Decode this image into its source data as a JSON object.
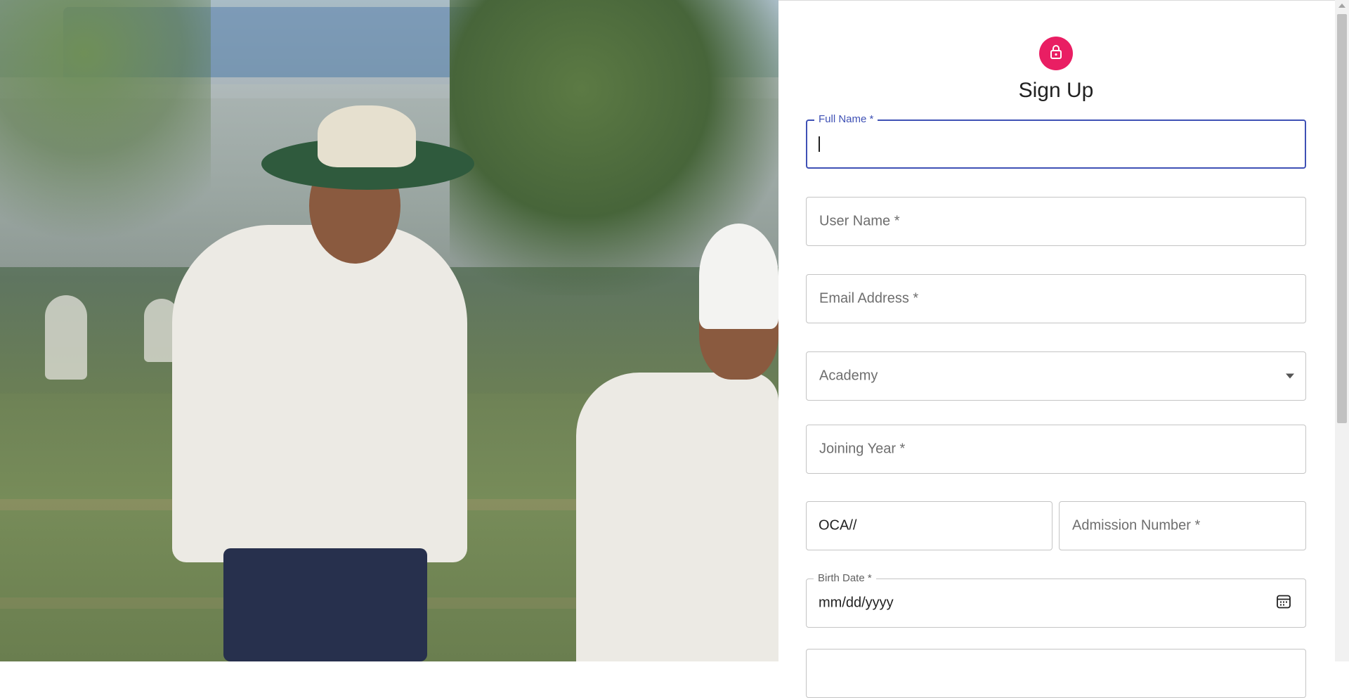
{
  "page": {
    "title": "Sign Up"
  },
  "theme": {
    "accent": "#e91e63",
    "focus": "#3f51b5",
    "border": "#c4c4c4"
  },
  "icons": {
    "lock": "lock-icon",
    "calendar": "calendar-icon",
    "dropdown": "chevron-down-icon"
  },
  "form": {
    "full_name": {
      "label": "Full Name *",
      "value": ""
    },
    "user_name": {
      "placeholder": "User Name *"
    },
    "email": {
      "placeholder": "Email Address *"
    },
    "academy": {
      "placeholder": "Academy"
    },
    "joining_year": {
      "placeholder": "Joining Year *"
    },
    "admission_prefix": {
      "value": "OCA//"
    },
    "admission_number": {
      "placeholder": "Admission Number *"
    },
    "birth_date": {
      "label": "Birth Date *",
      "value": "mm/dd/yyyy"
    }
  }
}
